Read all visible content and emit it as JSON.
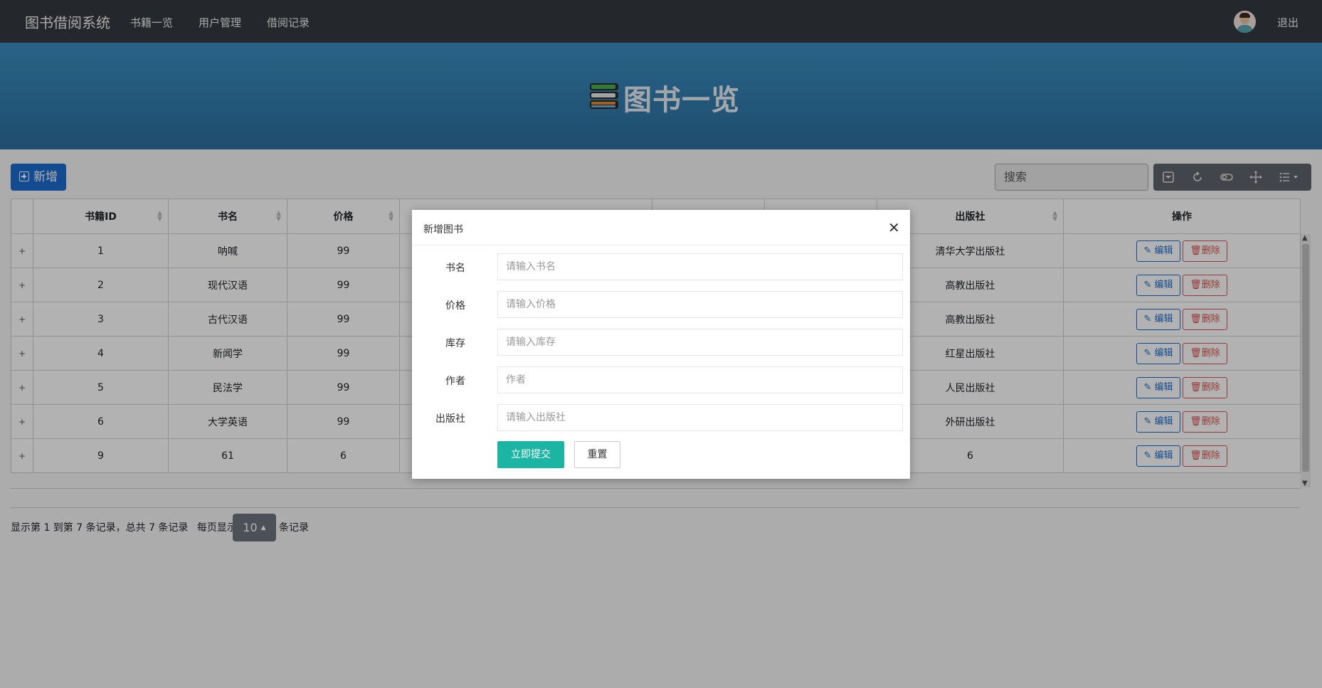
{
  "navbar": {
    "brand": "图书借阅系统",
    "links": [
      "书籍一览",
      "用户管理",
      "借阅记录"
    ],
    "logout": "退出"
  },
  "banner": {
    "title": "图书一览"
  },
  "toolbar": {
    "add_label": "新增",
    "search_placeholder": "搜索",
    "tool_icons": [
      "toggle-icon",
      "refresh-icon",
      "switch-icon",
      "fullscreen-icon",
      "columns-icon"
    ]
  },
  "table": {
    "headers": [
      "书籍ID",
      "书名",
      "价格",
      "",
      "",
      "",
      "出版社",
      "操作"
    ],
    "rows": [
      {
        "id": "1",
        "name": "呐喊",
        "price": "99",
        "publisher": "清华大学出版社"
      },
      {
        "id": "2",
        "name": "现代汉语",
        "price": "99",
        "publisher": "高教出版社"
      },
      {
        "id": "3",
        "name": "古代汉语",
        "price": "99",
        "publisher": "高教出版社"
      },
      {
        "id": "4",
        "name": "新闻学",
        "price": "99",
        "publisher": "红星出版社"
      },
      {
        "id": "5",
        "name": "民法学",
        "price": "99",
        "publisher": "人民出版社"
      },
      {
        "id": "6",
        "name": "大学英语",
        "price": "99",
        "publisher": "外研出版社"
      },
      {
        "id": "9",
        "name": "61",
        "price": "6",
        "publisher": "6"
      }
    ],
    "expand_symbol": "+",
    "edit_label": "编辑",
    "delete_label": "删除"
  },
  "pagination": {
    "summary": "显示第 1 到第 7 条记录，总共 7 条记录",
    "per_page_prefix": "每页显示",
    "page_size": "10",
    "per_page_suffix": "条记录"
  },
  "modal": {
    "title": "新增图书",
    "fields": [
      {
        "label": "书名",
        "placeholder": "请输入书名"
      },
      {
        "label": "价格",
        "placeholder": "请输入价格"
      },
      {
        "label": "库存",
        "placeholder": "请输入库存"
      },
      {
        "label": "作者",
        "placeholder": "作者"
      },
      {
        "label": "出版社",
        "placeholder": "请输入出版社"
      }
    ],
    "submit_label": "立即提交",
    "reset_label": "重置"
  },
  "colors": {
    "navbar": "#343a40",
    "banner": "#2f78ab",
    "primary": "#1c6cd0",
    "danger": "#d9534f",
    "submit": "#1cb5a3"
  }
}
